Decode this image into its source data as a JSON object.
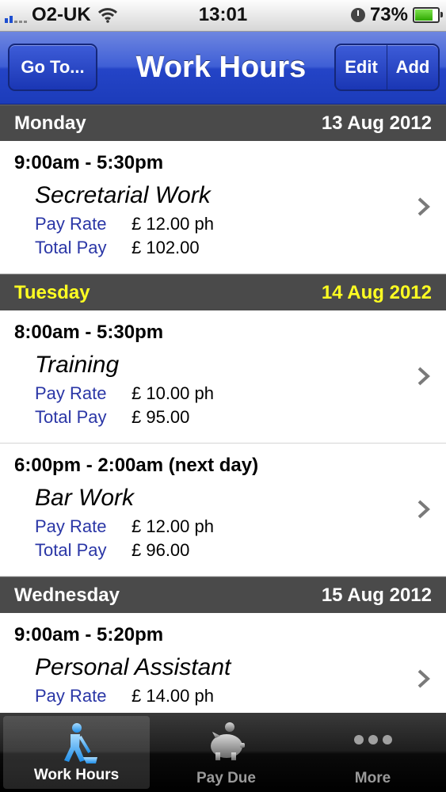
{
  "status_bar": {
    "carrier": "O2-UK",
    "time": "13:01",
    "battery_percent": "73%",
    "battery_level": 0.73
  },
  "nav": {
    "goto_label": "Go To...",
    "title": "Work Hours",
    "edit_label": "Edit",
    "add_label": "Add"
  },
  "labels": {
    "pay_rate": "Pay Rate",
    "total_pay": "Total Pay"
  },
  "sections": [
    {
      "day": "Monday",
      "date": "13 Aug 2012",
      "highlight": false,
      "entries": [
        {
          "time": "9:00am - 5:30pm",
          "job": "Secretarial Work",
          "pay_rate": "£ 12.00 ph",
          "total_pay": "£ 102.00"
        }
      ]
    },
    {
      "day": "Tuesday",
      "date": "14 Aug 2012",
      "highlight": true,
      "highlight_color": "#ffff22",
      "entries": [
        {
          "time": "8:00am - 5:30pm",
          "job": "Training",
          "pay_rate": "£ 10.00 ph",
          "total_pay": "£ 95.00"
        },
        {
          "time": "6:00pm - 2:00am (next day)",
          "job": "Bar Work",
          "pay_rate": "£ 12.00 ph",
          "total_pay": "£ 96.00"
        }
      ]
    },
    {
      "day": "Wednesday",
      "date": "15 Aug 2012",
      "highlight": false,
      "entries": [
        {
          "time": "9:00am - 5:20pm",
          "job": "Personal Assistant",
          "pay_rate": "£ 14.00 ph",
          "total_pay": ""
        }
      ]
    }
  ],
  "tabs": [
    {
      "label": "Work Hours",
      "icon": "worker-shovel-icon",
      "active": true
    },
    {
      "label": "Pay Due",
      "icon": "piggy-bank-icon",
      "active": false
    },
    {
      "label": "More",
      "icon": "more-dots-icon",
      "active": false
    }
  ],
  "colors": {
    "nav_blue": "#2444c7",
    "label_blue": "#2a36a6",
    "section_header": "#4a4a4a"
  }
}
